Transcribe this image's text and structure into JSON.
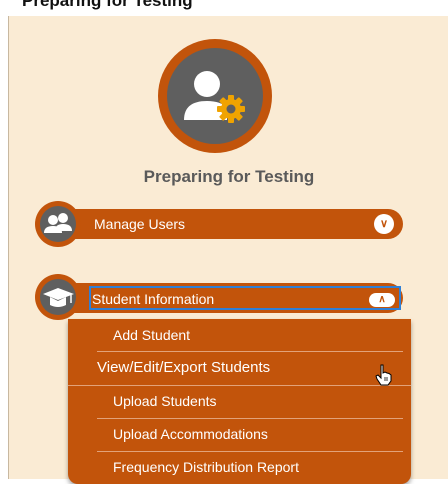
{
  "page_header": "Preparing for Testing",
  "section": {
    "title": "Preparing for Testing"
  },
  "menu": [
    {
      "label": "Manage Users",
      "icon": "users-icon",
      "expanded": false
    },
    {
      "label": "Student Information",
      "icon": "graduation-cap-icon",
      "expanded": true,
      "items": [
        {
          "label": "Add Student"
        },
        {
          "label": "View/Edit/Export Students"
        },
        {
          "label": "Upload Students"
        },
        {
          "label": "Upload Accommodations"
        },
        {
          "label": "Frequency Distribution Report"
        }
      ]
    }
  ],
  "colors": {
    "accent": "#c2540b",
    "panel_bg": "#faebd4",
    "icon_bg": "#5f5f5f",
    "title_text": "#5a5a5a",
    "focus": "#2f7fd6"
  }
}
